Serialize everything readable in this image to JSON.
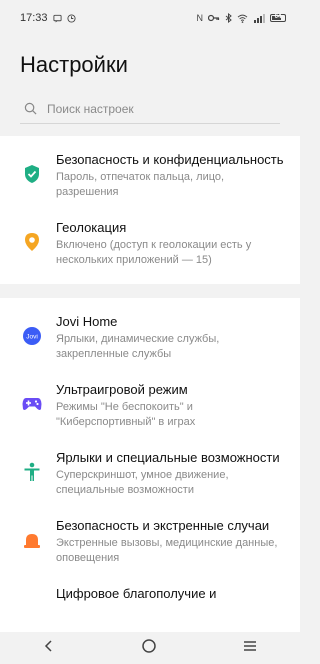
{
  "status": {
    "time": "17:33",
    "battery": "64"
  },
  "header": {
    "title": "Настройки",
    "search_placeholder": "Поиск настроек"
  },
  "group1": [
    {
      "title": "Безопасность и конфиденциальность",
      "subtitle": "Пароль, отпечаток пальца, лицо, разрешения",
      "icon": "shield-check-icon",
      "color": "#1fae84"
    },
    {
      "title": "Геолокация",
      "subtitle": "Включено (доступ к геолокации есть у нескольких приложений — 15)",
      "icon": "location-pin-icon",
      "color": "#f5a623"
    }
  ],
  "group2": [
    {
      "title": "Jovi Home",
      "subtitle": "Ярлыки, динамические службы, закрепленные службы",
      "icon": "jovi-icon",
      "icon_text": "Jovi",
      "color": "#3b5cf6"
    },
    {
      "title": "Ультраигровой режим",
      "subtitle": "Режимы \"Не беспокоить\" и \"Киберспортивный\" в играх",
      "icon": "gamepad-icon",
      "color": "#6a4cf5"
    },
    {
      "title": "Ярлыки и специальные возможности",
      "subtitle": "Суперскриншот, умное движение, специальные возможности",
      "icon": "accessibility-icon",
      "color": "#1fae84"
    },
    {
      "title": "Безопасность и экстренные случаи",
      "subtitle": "Экстренные вызовы, медицинские данные, оповещения",
      "icon": "emergency-light-icon",
      "color": "#ff7a2f"
    },
    {
      "title": "Цифровое благополучие и",
      "subtitle": "",
      "icon": "",
      "color": ""
    }
  ]
}
